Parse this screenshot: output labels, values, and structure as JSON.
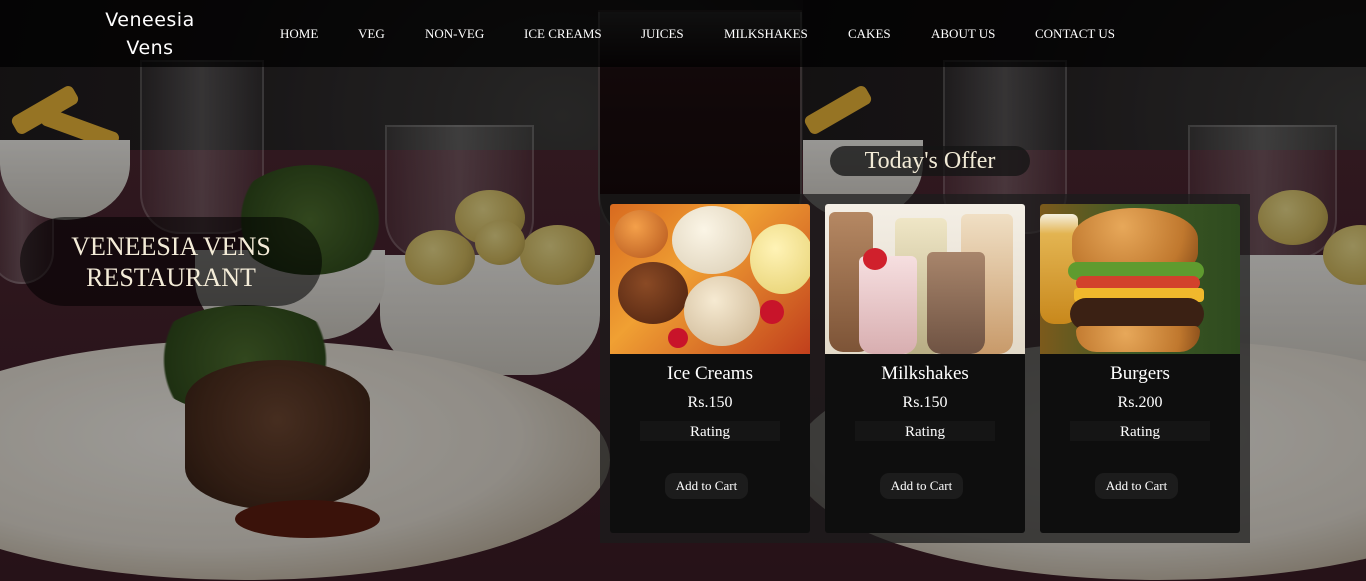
{
  "brand": {
    "name_line1": "Veneesia",
    "name_line2": "Vens"
  },
  "nav": {
    "items": [
      "HOME",
      "VEG",
      "NON-VEG",
      "ICE CREAMS",
      "JUICES",
      "MILKSHAKES",
      "CAKES",
      "ABOUT US",
      "CONTACT US"
    ]
  },
  "hero": {
    "line1": "VENEESIA VENS",
    "line2": "RESTAURANT"
  },
  "offer": {
    "title": "Today's Offer",
    "cards": [
      {
        "name": "Ice Creams",
        "price": "Rs.150",
        "rating_label": "Rating",
        "button_label": "Add to Cart"
      },
      {
        "name": "Milkshakes",
        "price": "Rs.150",
        "rating_label": "Rating",
        "button_label": "Add to Cart"
      },
      {
        "name": "Burgers",
        "price": "Rs.200",
        "rating_label": "Rating",
        "button_label": "Add to Cart"
      }
    ]
  },
  "colors": {
    "navbar_bg": "#000000",
    "nav_text": "#ffffff",
    "card_bg": "#0e0e0e",
    "hero_text": "#f4ecd8"
  }
}
